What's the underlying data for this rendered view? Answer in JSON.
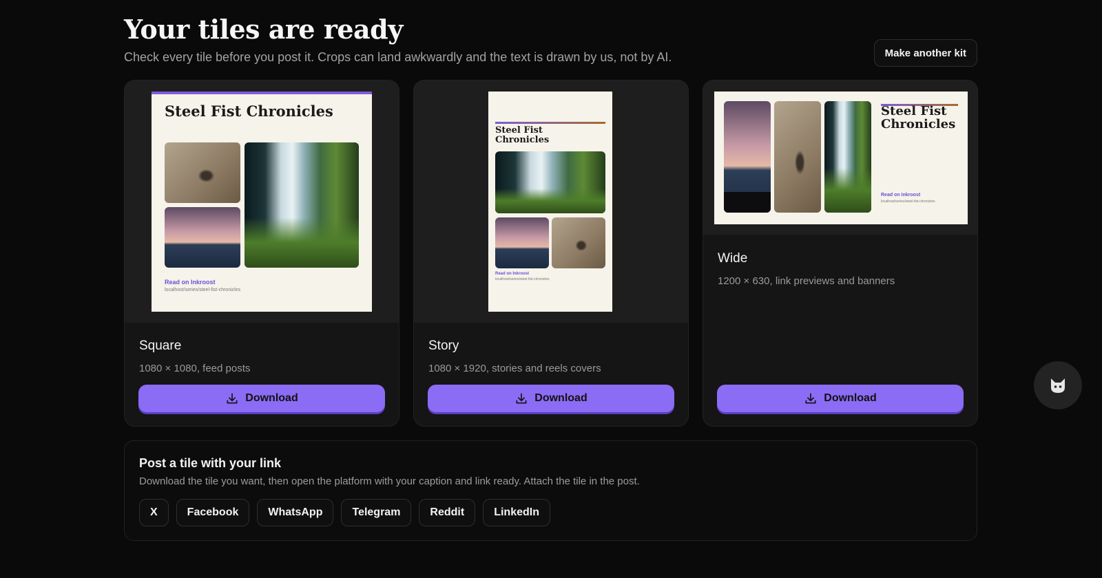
{
  "header": {
    "title": "Your tiles are ready",
    "subtitle": "Check every tile before you post it. Crops can land awkwardly and the text is drawn by us, not by AI.",
    "make_another_label": "Make another kit"
  },
  "tiles": [
    {
      "name": "Square",
      "description": "1080 × 1080, feed posts",
      "download_label": "Download",
      "preview": {
        "title": "Steel Fist Chronicles",
        "link_text": "Read on Inkroost",
        "url": "localhost/series/steel-fist-chronicles"
      }
    },
    {
      "name": "Story",
      "description": "1080 × 1920, stories and reels covers",
      "download_label": "Download",
      "preview": {
        "title": "Steel Fist Chronicles",
        "link_text": "Read on Inkroost",
        "url": "localhost/series/steel-fist-chronicles"
      }
    },
    {
      "name": "Wide",
      "description": "1200 × 630, link previews and banners",
      "download_label": "Download",
      "preview": {
        "title": "Steel Fist Chronicles",
        "link_text": "Read on Inkroost",
        "url": "localhost/series/steel-fist-chronicles"
      }
    }
  ],
  "post_section": {
    "title": "Post a tile with your link",
    "description": "Download the tile you want, then open the platform with your caption and link ready. Attach the tile in the post.",
    "platforms": [
      "X",
      "Facebook",
      "WhatsApp",
      "Telegram",
      "Reddit",
      "LinkedIn"
    ]
  },
  "colors": {
    "background": "#0a0a0a",
    "accent": "#8b6cf4",
    "card": "#151515",
    "link": "#6b4fd6"
  },
  "icons": {
    "download": "download-icon",
    "assistant": "cat-icon"
  }
}
